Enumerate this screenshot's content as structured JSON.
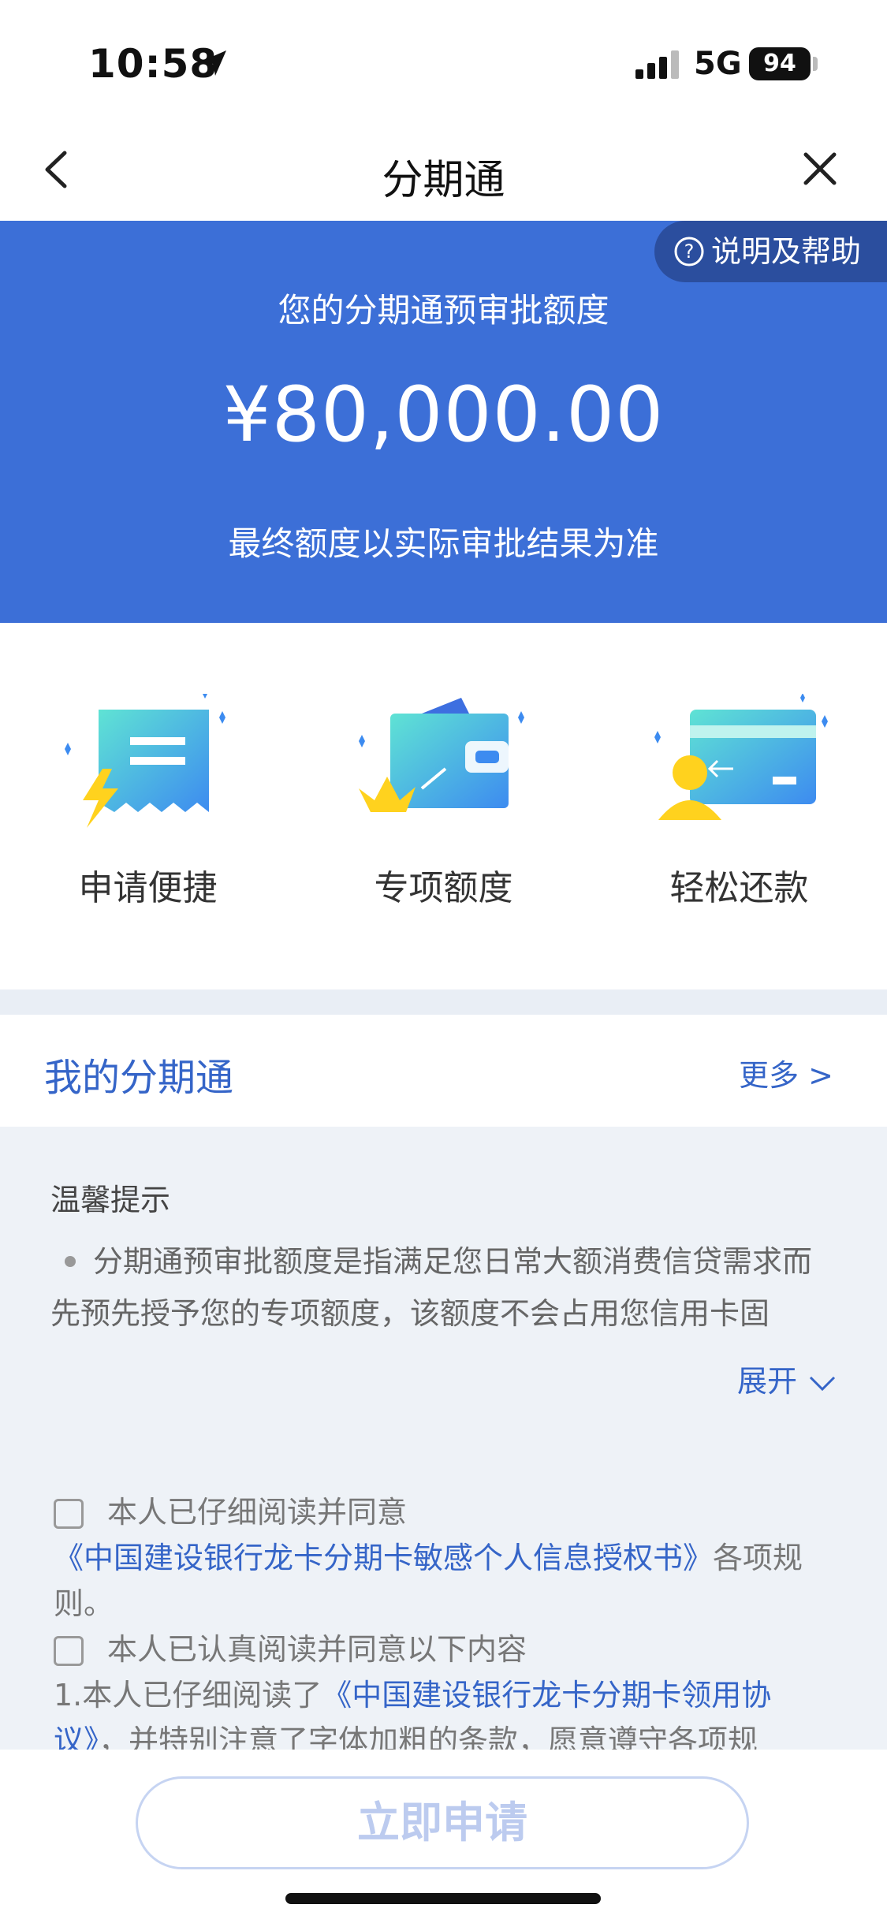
{
  "status": {
    "time": "10:58",
    "network": "5G",
    "battery": "94"
  },
  "nav": {
    "title": "分期通"
  },
  "hero": {
    "help_label": "说明及帮助",
    "label": "您的分期通预审批额度",
    "amount": "¥80,000.00",
    "note": "最终额度以实际审批结果为准"
  },
  "features": [
    {
      "label": "申请便捷"
    },
    {
      "label": "专项额度"
    },
    {
      "label": "轻松还款"
    }
  ],
  "my_section": {
    "title": "我的分期通",
    "more": "更多 >"
  },
  "tips": {
    "title": "温馨提示",
    "text": "分期通预审批额度是指满足您日常大额消费信贷需求而先预先授予您的专项额度，该额度不会占用您信用卡固",
    "expand": "展开"
  },
  "agreements": {
    "a1_prefix": "本人已仔细阅读并同意",
    "a1_link": "《中国建设银行龙卡分期卡敏感个人信息授权书》",
    "a1_suffix": "各项规则。",
    "a2_prefix": "本人已认真阅读并同意以下内容",
    "a2_line_prefix": "1.本人已仔细阅读了",
    "a2_link": "《中国建设银行龙卡分期卡领用协议》",
    "a2_suffix": "，并特别注意了字体加粗的条款，愿意遵守各项规"
  },
  "apply_button": "立即申请",
  "colors": {
    "primary": "#3c6fd7",
    "help_bg": "#2b4e9e",
    "link": "#3565c8",
    "page_bg": "#eef2f7"
  }
}
